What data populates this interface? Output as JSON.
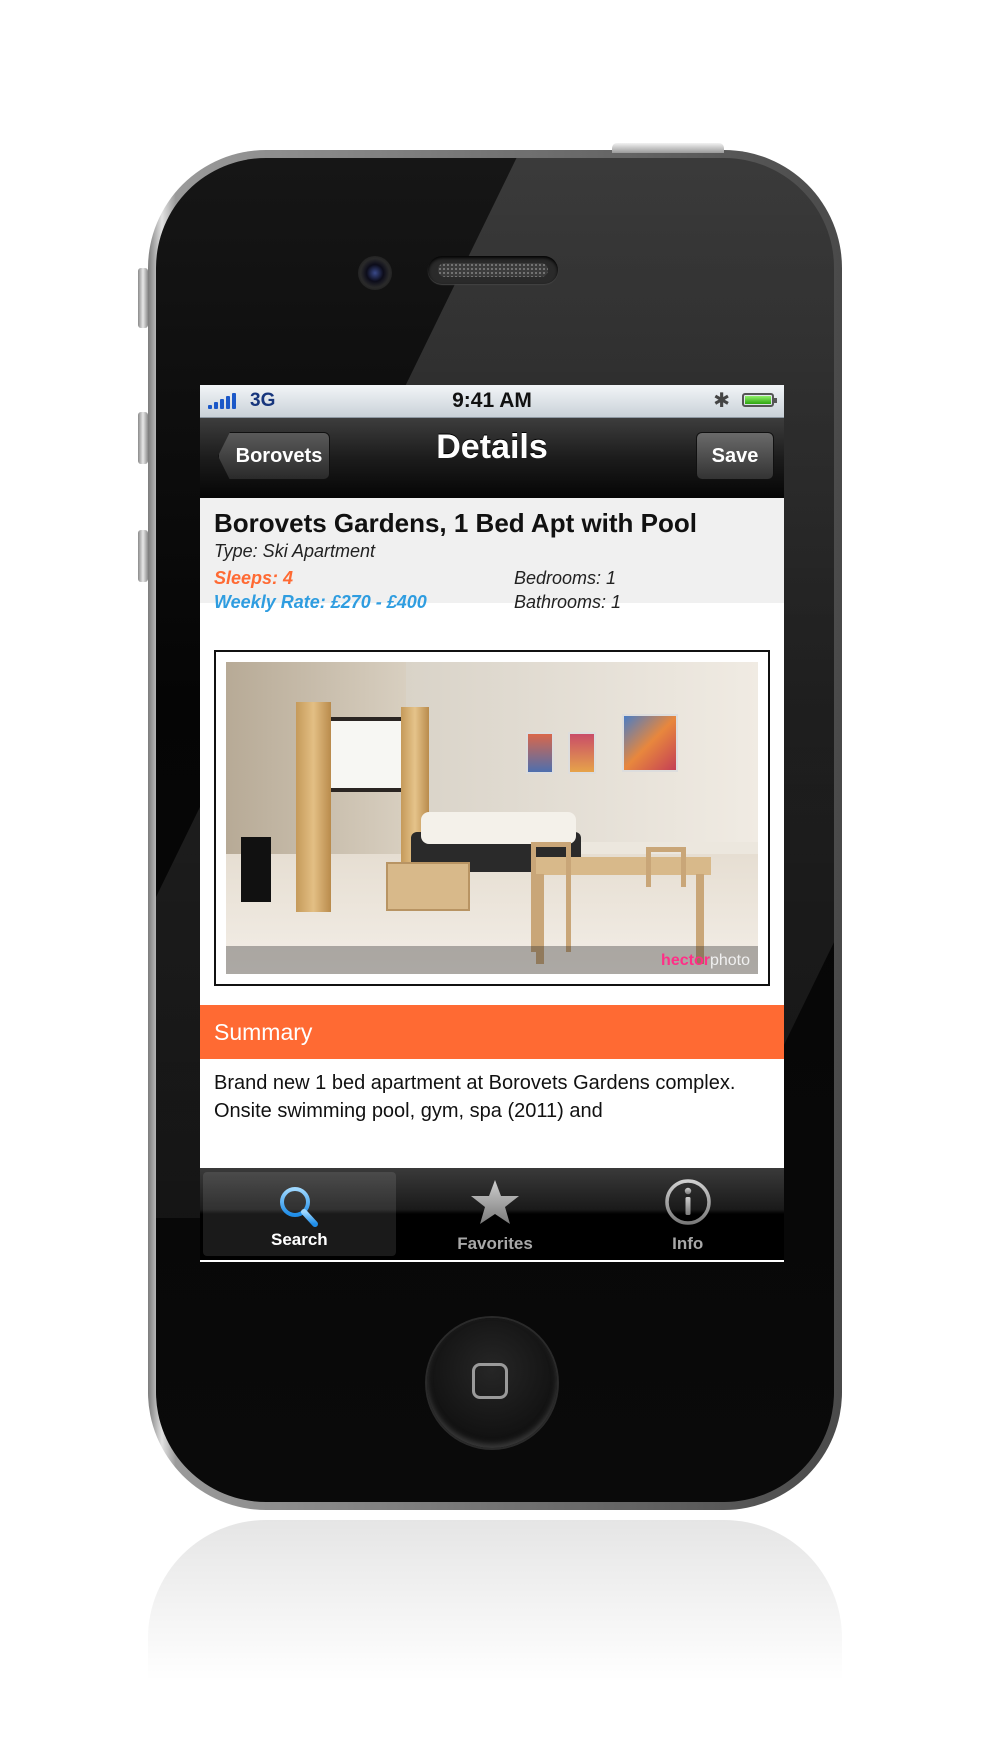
{
  "status_bar": {
    "carrier": "3G",
    "time": "9:41 AM"
  },
  "nav_bar": {
    "back_label": "Borovets",
    "title": "Details",
    "save_label": "Save"
  },
  "listing": {
    "title": "Borovets Gardens, 1 Bed Apt with Pool",
    "type": "Type: Ski Apartment",
    "sleeps": "Sleeps: 4",
    "weekly_rate": "Weekly Rate: £270 - £400",
    "bedrooms": "Bedrooms: 1",
    "bathrooms": "Bathrooms: 1",
    "photo_watermark_a": "hector",
    "photo_watermark_b": "photo"
  },
  "summary": {
    "header": "Summary",
    "text": "Brand new 1 bed apartment at Borovets Gardens complex. Onsite swimming pool, gym, spa (2011) and"
  },
  "tab_bar": {
    "tabs": [
      {
        "label": "Search",
        "icon": "search-icon",
        "active": true
      },
      {
        "label": "Favorites",
        "icon": "star-icon",
        "active": false
      },
      {
        "label": "Info",
        "icon": "info-icon",
        "active": false
      }
    ]
  },
  "colors": {
    "accent_orange": "#ff6a33",
    "rate_blue": "#2f9de0",
    "tab_active_blue": "#4fb4ff"
  }
}
